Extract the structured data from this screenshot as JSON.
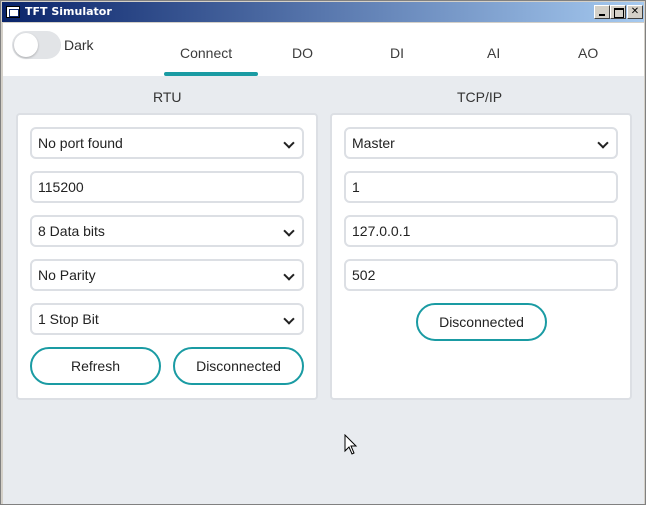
{
  "window": {
    "title": "TFT Simulator"
  },
  "header": {
    "theme_toggle": {
      "label": "Dark",
      "on": false
    },
    "tabs": [
      {
        "label": "Connect",
        "active": true
      },
      {
        "label": "DO"
      },
      {
        "label": "DI"
      },
      {
        "label": "AI"
      },
      {
        "label": "AO"
      }
    ]
  },
  "rtu": {
    "title": "RTU",
    "port": "No port found",
    "baud": "115200",
    "data_bits": "8 Data bits",
    "parity": "No Parity",
    "stop_bits": "1 Stop Bit",
    "refresh_label": "Refresh",
    "status_label": "Disconnected"
  },
  "tcp": {
    "title": "TCP/IP",
    "mode": "Master",
    "unit_id": "1",
    "ip": "127.0.0.1",
    "port": "502",
    "status_label": "Disconnected"
  },
  "colors": {
    "accent": "#1a9ba3",
    "titlebar": "#0a246a"
  }
}
